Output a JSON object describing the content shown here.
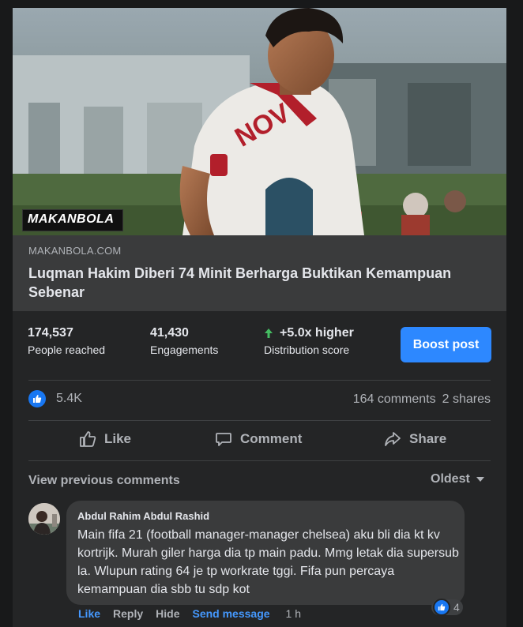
{
  "link_preview": {
    "watermark": "MAKANBOLA",
    "domain": "MAKANBOLA.COM",
    "title": "Luqman Hakim Diberi 74 Minit Berharga Buktikan Kemampuan Sebenar"
  },
  "insights": {
    "reach_value": "174,537",
    "reach_label": "People reached",
    "engagements_value": "41,430",
    "engagements_label": "Engagements",
    "distribution_value": "+5.0x higher",
    "distribution_label": "Distribution score",
    "boost_label": "Boost post"
  },
  "reactions": {
    "count": "5.4K",
    "comments": "164 comments",
    "shares": "2 shares"
  },
  "actions": {
    "like": "Like",
    "comment": "Comment",
    "share": "Share"
  },
  "comments_section": {
    "view_previous": "View previous comments",
    "sort": "Oldest"
  },
  "comment": {
    "author": "Abdul Rahim Abdul Rashid",
    "text": "Main fifa 21 (football manager-manager chelsea) aku bli dia kt kv kortrijk. Murah giler harga dia tp main padu. Mmg letak dia supersub la. Wlupun rating 64 je tp workrate tggi. Fifa pun percaya kemampuan dia sbb tu sdp kot",
    "reaction_count": "4",
    "like": "Like",
    "reply": "Reply",
    "hide": "Hide",
    "send_message": "Send message",
    "time": "1 h"
  },
  "colors": {
    "accent": "#2d88ff",
    "card_bg": "#242526",
    "surface": "#3a3b3c",
    "growth_green": "#45bd62"
  }
}
